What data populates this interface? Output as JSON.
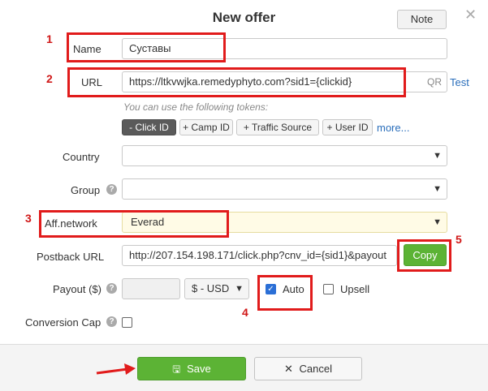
{
  "dialog": {
    "title": "New offer",
    "note_label": "Note",
    "close_icon": "close-icon"
  },
  "annotations": {
    "n1": "1",
    "n2": "2",
    "n3": "3",
    "n4": "4",
    "n5": "5",
    "color": "#e11b1b"
  },
  "form": {
    "name_label": "Name",
    "name_value": "Суставы",
    "url_label": "URL",
    "url_value": "https://ltkvwjka.remedyphyto.com?sid1={clickid}",
    "qr_label": "QR",
    "test_label": "Test",
    "tokens_hint": "You can use the following tokens:",
    "tokens": [
      "- Click ID",
      "+ Camp ID",
      "+ Traffic Source",
      "+ User ID"
    ],
    "more_label": "more...",
    "country_label": "Country",
    "country_value": "",
    "group_label": "Group",
    "group_value": "",
    "affnetwork_label": "Aff.network",
    "affnetwork_value": "Everad",
    "postback_label": "Postback URL",
    "postback_value": "http://207.154.198.171/click.php?cnv_id={sid1}&payout",
    "copy_label": "Copy",
    "payout_label": "Payout ($)",
    "payout_value": "",
    "currency_value": "$ - USD",
    "auto_label": "Auto",
    "auto_checked": true,
    "upsell_label": "Upsell",
    "upsell_checked": false,
    "conversion_cap_label": "Conversion Cap",
    "conversion_cap_checked": false
  },
  "footer": {
    "save_label": "Save",
    "cancel_label": "Cancel"
  },
  "colors": {
    "accent_green": "#5cb335",
    "link_blue": "#2a6ebb",
    "annotation_red": "#e11b1b"
  }
}
